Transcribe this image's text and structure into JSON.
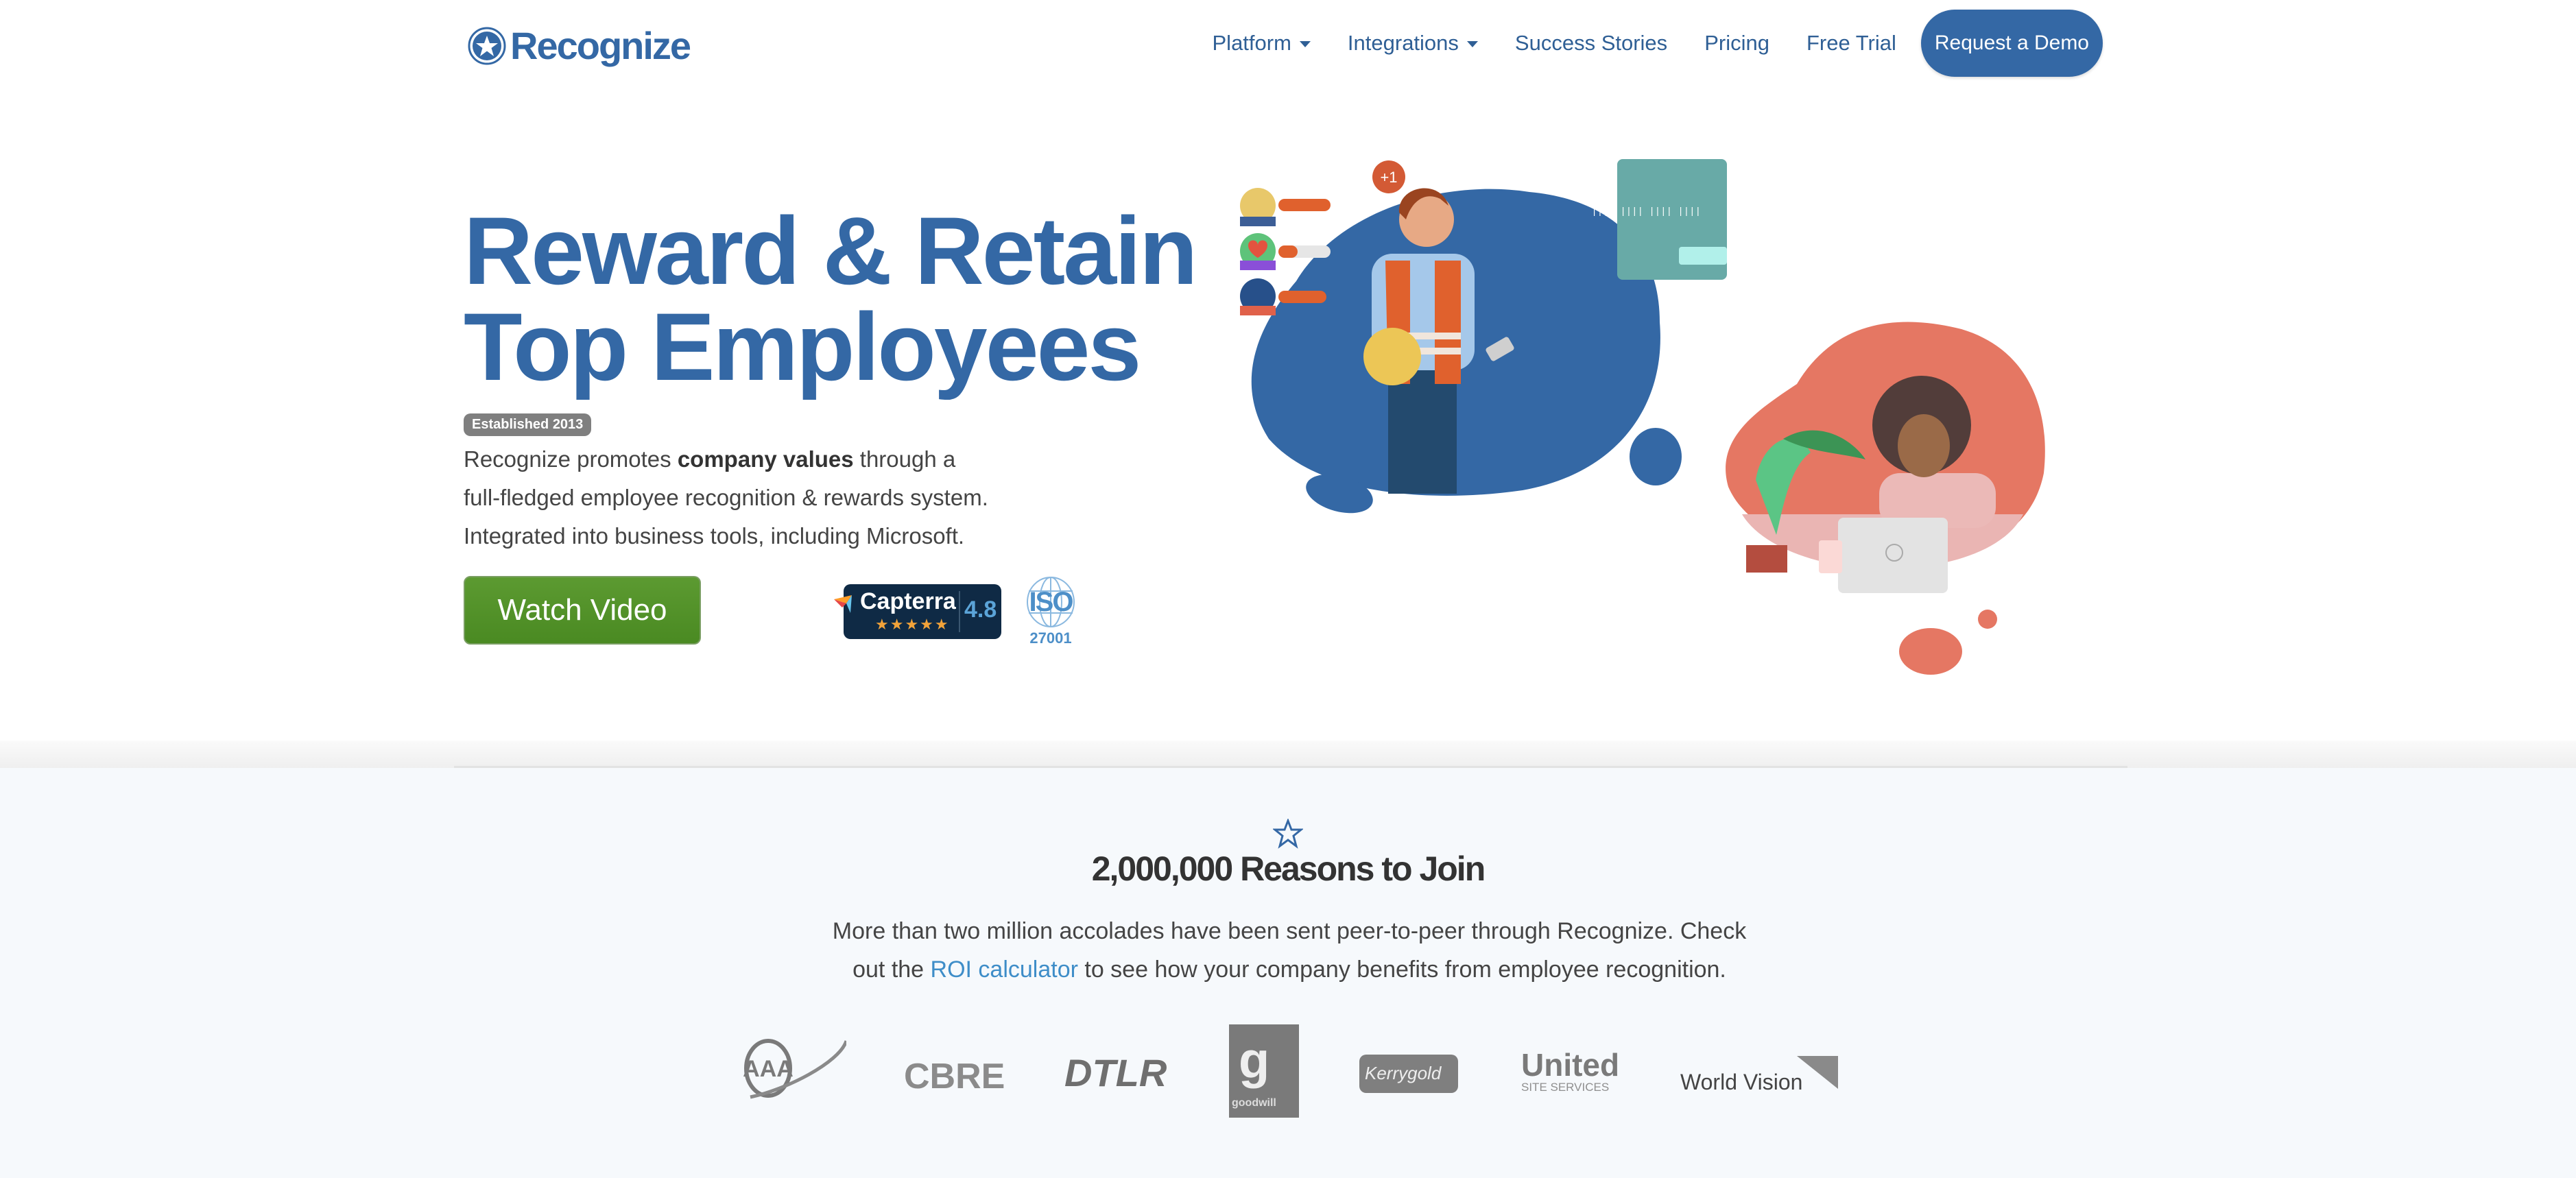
{
  "nav": {
    "brand": "Recognize",
    "menu": [
      {
        "label": "Platform",
        "has_dropdown": true
      },
      {
        "label": "Integrations",
        "has_dropdown": true
      },
      {
        "label": "Success Stories",
        "has_dropdown": false
      },
      {
        "label": "Pricing",
        "has_dropdown": false
      },
      {
        "label": "Free Trial",
        "has_dropdown": false
      }
    ],
    "cta": "Request a Demo"
  },
  "hero": {
    "title_line1": "Reward & Retain",
    "title_line2": "Top Employees",
    "badge": "Established 2013",
    "desc_part1": "Recognize promotes ",
    "desc_bold": "company values",
    "desc_part2": " through a",
    "desc_line2": "full-fledged employee recognition & rewards system.",
    "desc_line3": "Integrated into business tools, including Microsoft.",
    "watch_video": "Watch Video",
    "capterra": {
      "name": "Capterra",
      "stars": "★★★★★",
      "score": "4.8"
    },
    "iso": {
      "label": "ISO",
      "number": "27001"
    },
    "illustration": {
      "plus_badge": "+1"
    }
  },
  "reasons": {
    "title": "2,000,000 Reasons to Join",
    "desc_line1": "More than two million accolades have been sent peer-to-peer through Recognize. Check",
    "desc_line2_pre": "out the ",
    "roi_link": "ROI calculator",
    "desc_line2_post": " to see how your company benefits from employee recognition."
  },
  "customer_logos": [
    "AAA",
    "CBRE",
    "DTLR",
    "goodwill",
    "Kerrygold",
    "United",
    "SITE SERVICES",
    "World Vision"
  ],
  "colors": {
    "brand_blue": "#3468a5",
    "cta_green": "#4a8a22",
    "coral": "#e57763",
    "link_blue": "#3e8dc8"
  }
}
